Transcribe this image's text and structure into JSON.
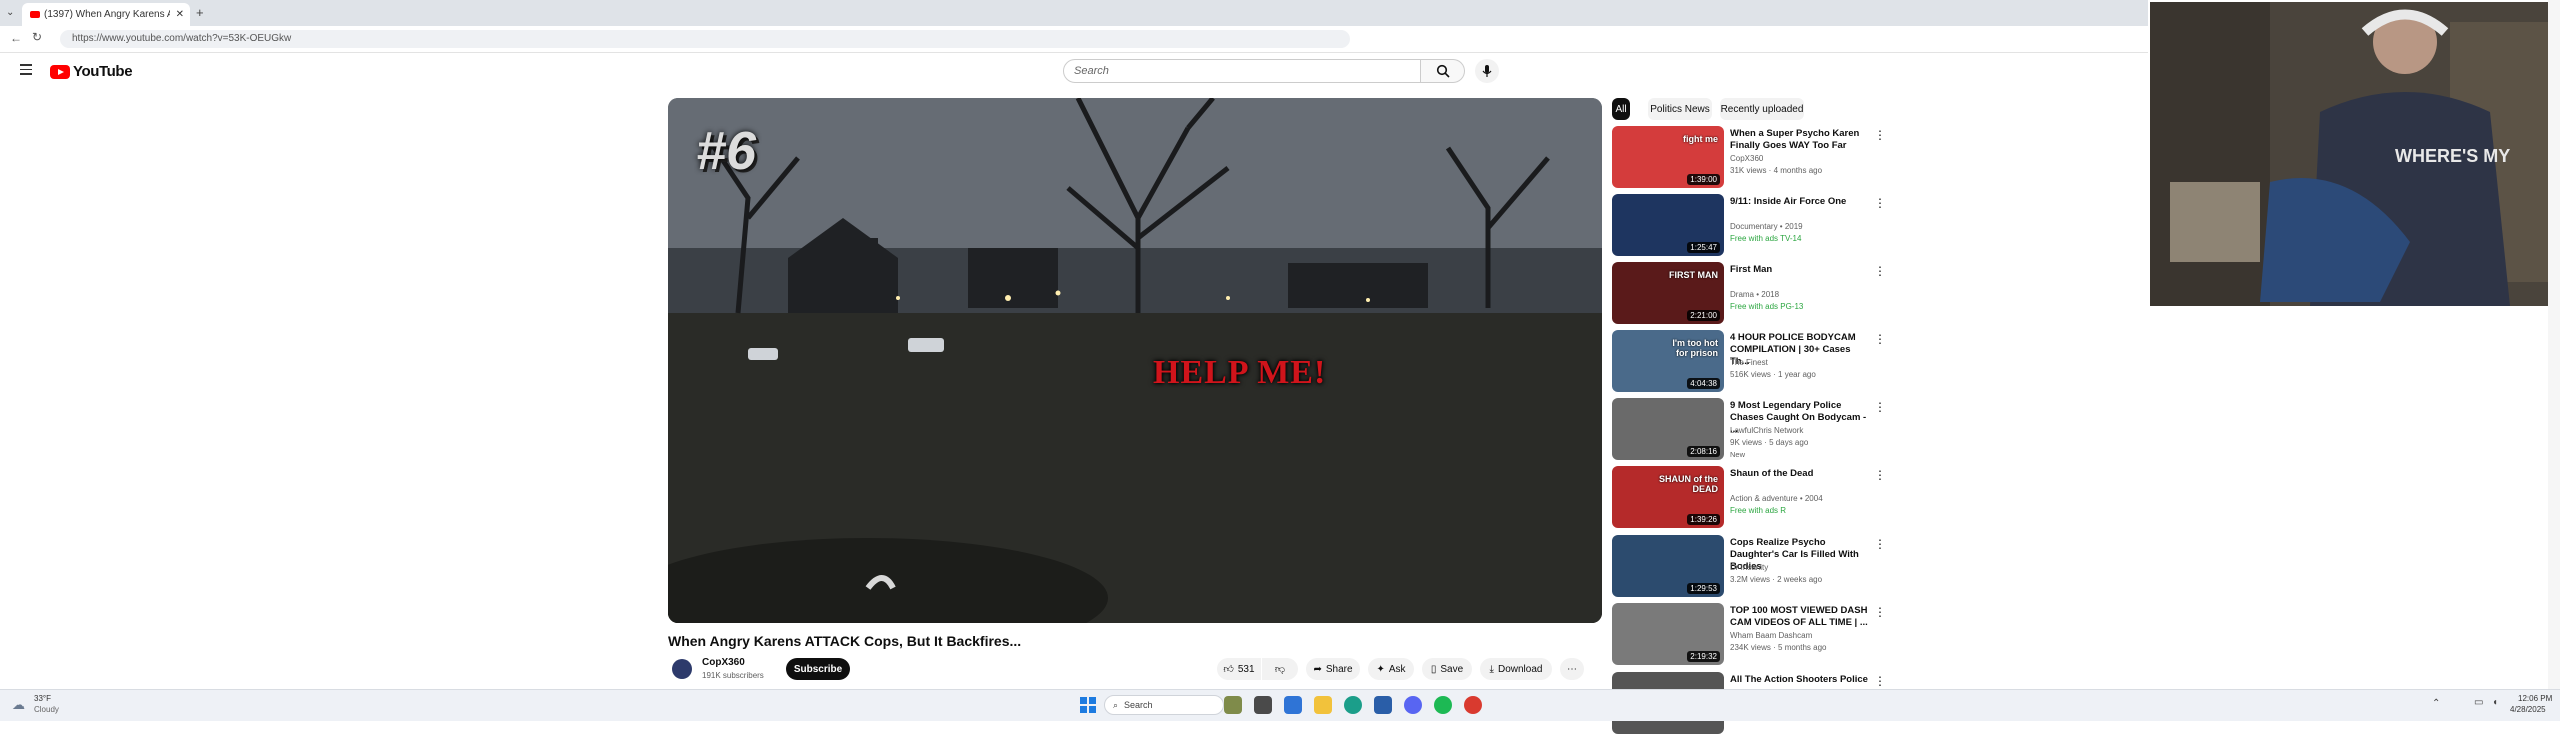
{
  "browser": {
    "tab_title": "(1397) When Angry Karens A",
    "url": "https://www.youtube.com/watch?v=53K-OEUGkw"
  },
  "header": {
    "logo_text": "YouTube",
    "search_placeholder": "Search"
  },
  "video": {
    "overlay_number": "#6",
    "overlay_caption": "HELP ME!",
    "title": "When Angry Karens ATTACK Cops, But It Backfires...",
    "channel": "CopX360",
    "subscribers": "191K subscribers",
    "subscribe_label": "Subscribe",
    "likes": "531",
    "share_label": "Share",
    "ask_label": "Ask",
    "save_label": "Save",
    "download_label": "Download"
  },
  "chips": [
    "All",
    "Politics News",
    "Recently uploaded"
  ],
  "recommendations": [
    {
      "title": "When a Super Psycho Karen Finally Goes WAY Too Far",
      "channel": "CopX360",
      "meta": "31K views · 4 months ago",
      "badge": "",
      "duration": "1:39:00",
      "thumb_color": "#d43c3c",
      "thumb_text": "fight me"
    },
    {
      "title": "9/11: Inside Air Force One",
      "channel": "Documentary • 2019",
      "meta": "Free with ads   TV-14",
      "badge": "",
      "duration": "1:25:47",
      "thumb_color": "#1e3560",
      "thumb_text": ""
    },
    {
      "title": "First Man",
      "channel": "Drama • 2018",
      "meta": "Free with ads   PG-13",
      "badge": "",
      "duration": "2:21:00",
      "thumb_color": "#5a1a1a",
      "thumb_text": "FIRST MAN"
    },
    {
      "title": "4 HOUR POLICE BODYCAM COMPILATION | 30+ Cases Th...",
      "channel": "The Finest",
      "meta": "516K views · 1 year ago",
      "badge": "",
      "duration": "4:04:38",
      "thumb_color": "#4a6a8a",
      "thumb_text": "I'm too hot for prison"
    },
    {
      "title": "9 Most Legendary Police Chases Caught On Bodycam - ...",
      "channel": "LawfulChris Network",
      "meta": "9K views · 5 days ago",
      "badge": "New",
      "duration": "2:08:16",
      "thumb_color": "#6a6a6a",
      "thumb_text": ""
    },
    {
      "title": "Shaun of the Dead",
      "channel": "Action & adventure • 2004",
      "meta": "Free with ads   R",
      "badge": "",
      "duration": "1:39:26",
      "thumb_color": "#b52a2a",
      "thumb_text": "SHAUN of the DEAD"
    },
    {
      "title": "Cops Realize Psycho Daughter's Car Is Filled With Bodies",
      "channel": "Dr Insanity",
      "meta": "3.2M views · 2 weeks ago",
      "badge": "",
      "duration": "1:29:53",
      "thumb_color": "#2c4b6e",
      "thumb_text": ""
    },
    {
      "title": "TOP 100 MOST VIEWED DASH CAM VIDEOS OF ALL TIME | ...",
      "channel": "Wham Baam Dashcam",
      "meta": "234K views · 5 months ago",
      "badge": "",
      "duration": "2:19:32",
      "thumb_color": "#7a7a7a",
      "thumb_text": ""
    },
    {
      "title": "All The Action Shooters Police ...",
      "channel": "",
      "meta": "",
      "badge": "",
      "duration": "",
      "thumb_color": "#555555",
      "thumb_text": ""
    }
  ],
  "webcam": {
    "shirt_text": "WHERE'S MY"
  },
  "taskbar": {
    "weather_temp": "33°F",
    "weather_desc": "Cloudy",
    "search_label": "Search",
    "time": "12:06 PM",
    "date": "4/28/2025"
  },
  "colors": {
    "accent_red": "#ff0000",
    "caption_red": "#d0141b",
    "chip_active": "#0f0f0f"
  }
}
